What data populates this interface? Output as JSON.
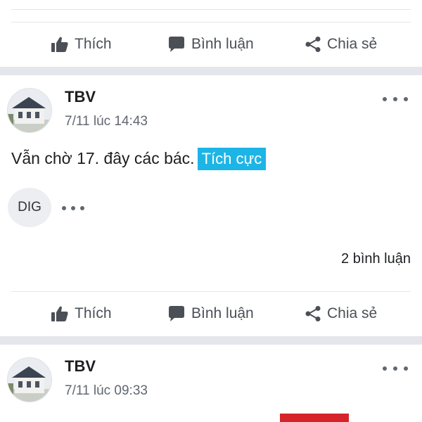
{
  "actions": {
    "like_label": "Thích",
    "comment_label": "Bình luận",
    "share_label": "Chia sẻ"
  },
  "posts": [
    {
      "author": "TBV",
      "timestamp": "7/11 lúc 14:43",
      "text": "Vẫn chờ 17. đây các bác.",
      "tag": "Tích cực",
      "tag_color": "#1db5e6",
      "reaction_avatar": "DIG",
      "comment_count": "2 bình luận"
    },
    {
      "author": "TBV",
      "timestamp": "7/11 lúc 09:33",
      "text": "",
      "tag": "",
      "tag_color": "#d6232a"
    }
  ],
  "icons": {
    "like": "thumbs-up-icon",
    "comment": "comment-bubble-icon",
    "share": "share-icon",
    "more": "more-options-icon"
  },
  "colors": {
    "text": "#1c1e21",
    "secondary": "#606770",
    "separator": "#e4e6eb"
  }
}
